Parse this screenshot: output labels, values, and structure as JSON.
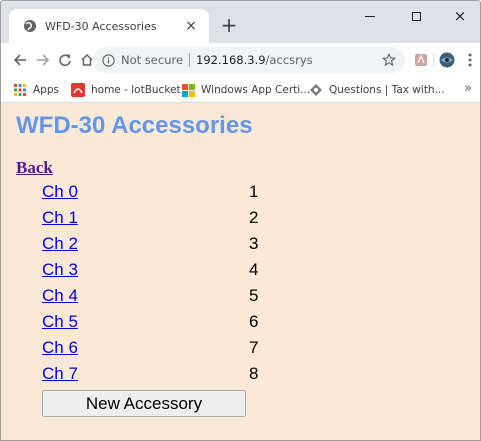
{
  "browser": {
    "tab_title": "WFD-30 Accessories",
    "tab_close": "×",
    "new_tab": "+",
    "window_close": "×",
    "security_label": "Not secure",
    "url_host": "192.168.3.9",
    "url_path": "/accsrys",
    "bookmarks": [
      {
        "label": "Apps",
        "icon": "apps-grid-icon"
      },
      {
        "label": "home - lotBucket",
        "icon": "lotbucket-icon"
      },
      {
        "label": "Windows App Certi...",
        "icon": "windows-icon"
      },
      {
        "label": "Questions | Tax with...",
        "icon": "tax-icon"
      }
    ],
    "bookmarks_overflow": "»"
  },
  "page": {
    "title": "WFD-30 Accessories",
    "back_label": "Back",
    "channels": [
      {
        "label": "Ch 0",
        "value": "1"
      },
      {
        "label": "Ch 1",
        "value": "2"
      },
      {
        "label": "Ch 2",
        "value": "3"
      },
      {
        "label": "Ch 3",
        "value": "4"
      },
      {
        "label": "Ch 4",
        "value": "5"
      },
      {
        "label": "Ch 5",
        "value": "6"
      },
      {
        "label": "Ch 6",
        "value": "7"
      },
      {
        "label": "Ch 7",
        "value": "8"
      }
    ],
    "new_button_label": "New Accessory"
  },
  "colors": {
    "page_background": "#f9e9d6",
    "title": "#6495ed",
    "link": "#0000ee",
    "visited_link": "#551a8b"
  }
}
